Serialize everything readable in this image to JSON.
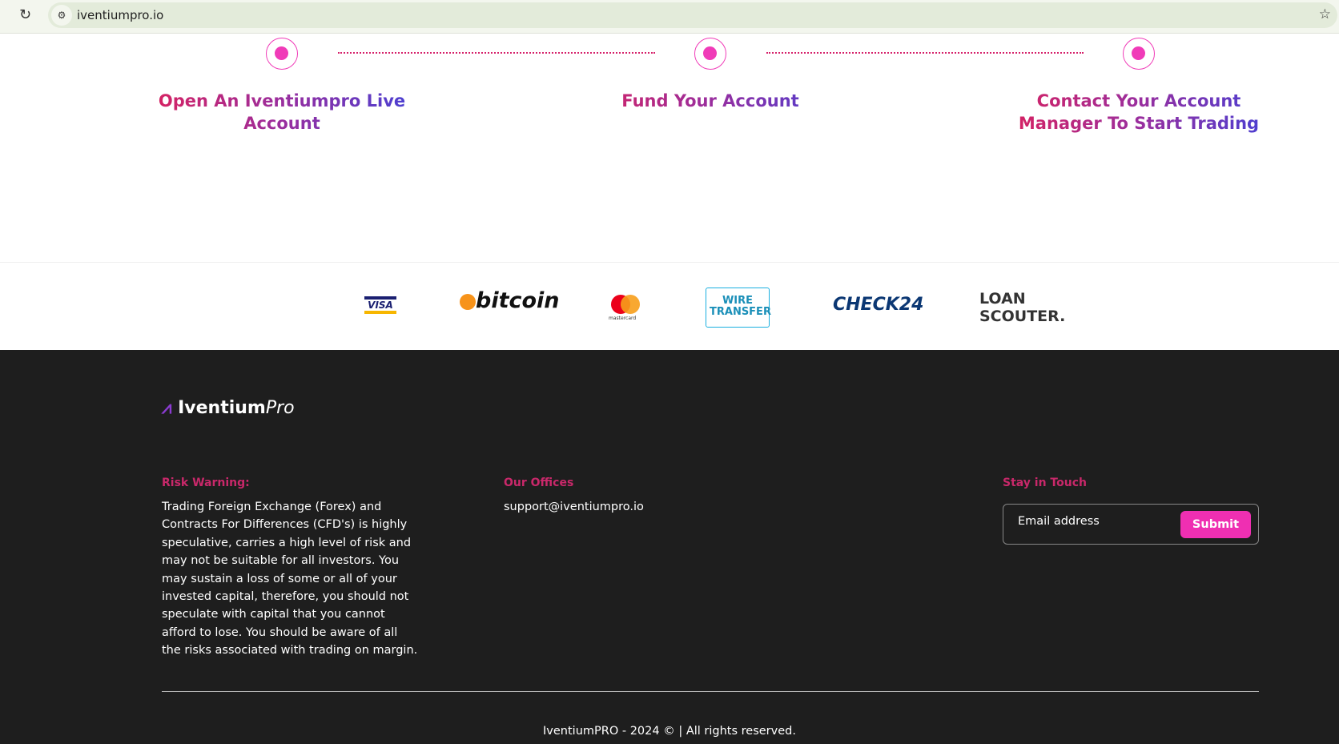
{
  "browser": {
    "url": "iventiumpro.io"
  },
  "steps": [
    {
      "title": "Open An Iventiumpro Live Account"
    },
    {
      "title": "Fund Your Account"
    },
    {
      "title": "Contact Your Account Manager To Start Trading"
    }
  ],
  "payment_logos": [
    "VISA",
    "bitcoin",
    "mastercard",
    "WIRE TRANSFER",
    "CHECK24",
    "LOAN SCOUTER."
  ],
  "footer": {
    "brand": {
      "main": "Iventium",
      "suffix": "Pro"
    },
    "risk": {
      "heading": "Risk Warning:",
      "text": "Trading Foreign Exchange (Forex) and Contracts For Differences (CFD's) is highly speculative, carries a high level of risk and may not be suitable for all investors. You may sustain a loss of some or all of your invested capital, therefore, you should not speculate with capital that you cannot afford to lose. You should be aware of all the risks associated with trading on margin."
    },
    "offices": {
      "heading": "Our Offices",
      "email": "support@iventiumpro.io"
    },
    "newsletter": {
      "heading": "Stay in Touch",
      "placeholder": "Email address",
      "submit": "Submit"
    },
    "copyright": "IventiumPRO - 2024 © | All rights reserved."
  },
  "colors": {
    "accent": "#ef2fb2",
    "heading": "#c9286a",
    "footer_bg": "#1e1e1e"
  }
}
